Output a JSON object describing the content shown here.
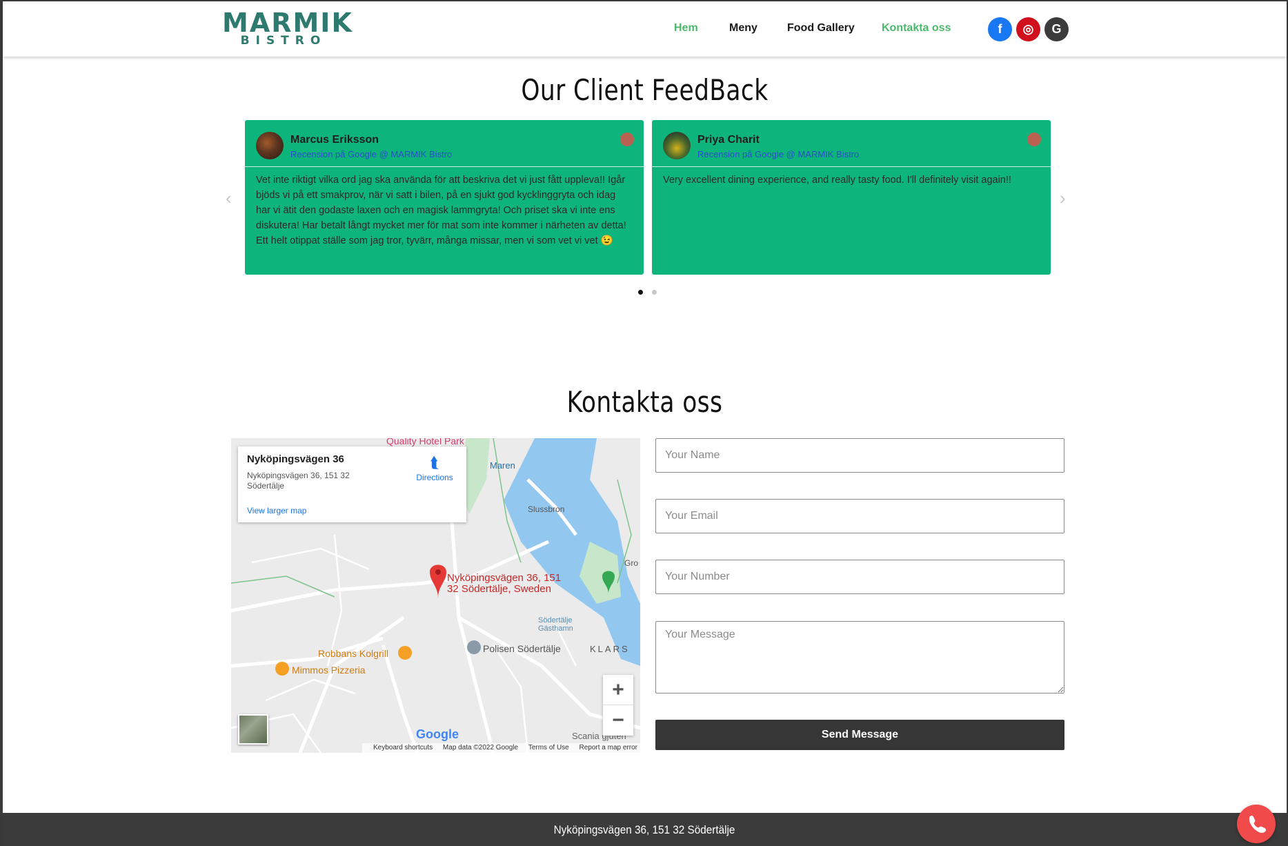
{
  "header": {
    "logo_line1": "MARMIK",
    "logo_line2": "BISTRO",
    "nav": [
      {
        "label": "Hem",
        "active": true
      },
      {
        "label": "Meny",
        "active": false
      },
      {
        "label": "Food Gallery",
        "active": false
      },
      {
        "label": "Kontakta oss",
        "active": true
      }
    ],
    "social": [
      {
        "icon": "facebook-icon",
        "glyph": "f",
        "color": "#1877f2"
      },
      {
        "icon": "instagram-icon",
        "glyph": "◎",
        "color": "#d0101c"
      },
      {
        "icon": "google-icon",
        "glyph": "G",
        "color": "#3b3b3b"
      }
    ]
  },
  "feedback": {
    "title": "Our Client FeedBack",
    "reviews": [
      {
        "name": "Marcus Eriksson",
        "source": "Recension på Google @ MARMIK Bistro",
        "text": "Vet inte riktigt vilka ord jag ska använda för att beskriva det vi just fått uppleva!! Igår bjöds vi på ett smakprov, när vi satt i bilen, på en sjukt god kycklinggryta och idag har vi ätit den godaste laxen och en magisk lammgryta! Och priset ska vi inte ens diskutera! Har betalt långt mycket mer för mat som inte kommer i närheten av detta! Ett helt otippat ställe som jag tror, tyvärr, många missar, men vi som vet vi vet 😉"
      },
      {
        "name": "Priya Charit",
        "source": "Recension på Google @ MARMIK Bistro",
        "text": "Very excellent dining experience, and really tasty food. I'll definitely visit again!!"
      }
    ],
    "prev_arrow": "‹",
    "next_arrow": "›",
    "active_slide": 1,
    "slide_count": 2,
    "colors": {
      "card": "#0db47b",
      "source_link": "#2a4bd0"
    }
  },
  "contact": {
    "title": "Kontakta oss",
    "map": {
      "card_title": "Nyköpingsvägen 36",
      "card_address": "Nyköpingsvägen 36, 151 32 Södertälje",
      "view_larger": "View larger map",
      "directions": "Directions",
      "pin_label": "Nyköpingsvägen 36, 151 32 Södertälje, Sweden",
      "places": {
        "quality": "Quality Hotel Park",
        "robbans": "Robbans Kolgrill",
        "mimmos": "Mimmos Pizzeria",
        "polisen": "Polisen Södertälje",
        "klars": "KLARS",
        "maren": "Maren",
        "slussbron": "Slussbron",
        "gasthamn": "Södertälje Gästhamn",
        "scania": "Scania gjuteri",
        "grod": "Gro"
      },
      "zoom_in": "+",
      "zoom_out": "−",
      "google": "Google",
      "footer": {
        "shortcuts": "Keyboard shortcuts",
        "mapdata": "Map data ©2022 Google",
        "terms": "Terms of Use",
        "report": "Report a map error"
      }
    },
    "form": {
      "name_placeholder": "Your Name",
      "email_placeholder": "Your Email",
      "number_placeholder": "Your Number",
      "message_placeholder": "Your Message",
      "submit": "Send Message"
    }
  },
  "footer": {
    "address": "Nyköpingsvägen 36, 151 32 Södertälje",
    "call_icon": "phone-icon"
  }
}
